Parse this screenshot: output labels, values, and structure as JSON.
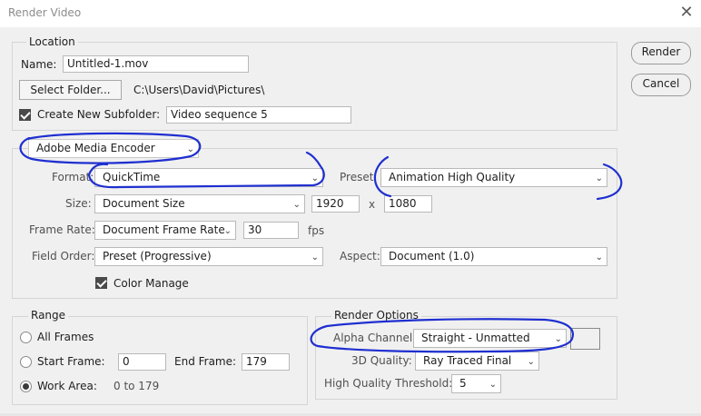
{
  "window": {
    "title": "Render Video",
    "close_symbol": "✕"
  },
  "buttons": {
    "render": "Render",
    "cancel": "Cancel"
  },
  "location": {
    "legend": "Location",
    "name_label": "Name:",
    "name_value": "Untitled-1.mov",
    "select_folder": "Select Folder...",
    "folder_path": "C:\\Users\\David\\Pictures\\",
    "subfolder_label": "Create New Subfolder:",
    "subfolder_checked": true,
    "subfolder_value": "Video sequence 5"
  },
  "encoder": {
    "selected": "Adobe Media Encoder",
    "format_label": "Format:",
    "format_value": "QuickTime",
    "preset_label": "Preset:",
    "preset_value": "Animation High Quality",
    "size_label": "Size:",
    "size_value": "Document Size",
    "width": "1920",
    "x_sep": "x",
    "height": "1080",
    "framerate_label": "Frame Rate:",
    "framerate_value": "Document Frame Rate",
    "fps_value": "30",
    "fps_unit": "fps",
    "fieldorder_label": "Field Order:",
    "fieldorder_value": "Preset (Progressive)",
    "aspect_label": "Aspect:",
    "aspect_value": "Document (1.0)",
    "color_manage_label": "Color Manage",
    "color_manage_checked": true
  },
  "range": {
    "legend": "Range",
    "all_frames": "All Frames",
    "start_frame_label": "Start Frame:",
    "start_frame_value": "0",
    "end_frame_label": "End Frame:",
    "end_frame_value": "179",
    "work_area_label": "Work Area:",
    "work_area_value": "0 to 179",
    "selected": "work_area"
  },
  "render_options": {
    "legend": "Render Options",
    "alpha_label": "Alpha Channel:",
    "alpha_value": "Straight - Unmatted",
    "quality3d_label": "3D Quality:",
    "quality3d_value": "Ray Traced Final",
    "hq_threshold_label": "High Quality Threshold:",
    "hq_threshold_value": "5"
  },
  "colors": {
    "annotation_ink": "#1f2fd0",
    "background": "#f0f0f0",
    "border": "#d5d5d5"
  }
}
